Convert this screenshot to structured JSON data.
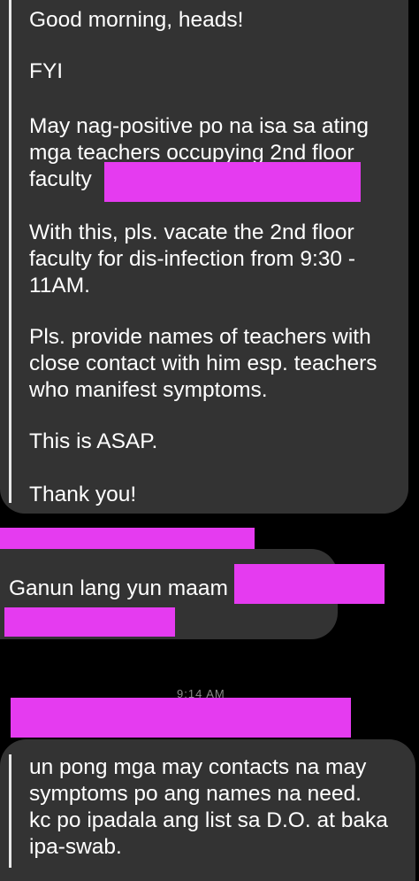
{
  "message1": {
    "greeting": "Good morning, heads!",
    "fyi": "FYI",
    "p1_l1": "May nag-positive po na isa sa ating",
    "p1_l2": "mga teachers occupying 2nd floor",
    "p1_l3": "faculty",
    "p2_l1": "With this, pls. vacate the 2nd floor",
    "p2_l2": "faculty for dis-infection from 9:30 -",
    "p2_l3": "11AM.",
    "p3_l1": "Pls. provide names of teachers with",
    "p3_l2": "close contact with him esp. teachers",
    "p3_l3": "who manifest symptoms.",
    "asap": "This is ASAP.",
    "thanks": "Thank you!"
  },
  "message2": {
    "text": "Ganun lang yun maam"
  },
  "timestamp": "9:14 AM",
  "message3": {
    "l1": "un pong mga may contacts na may",
    "l2": "symptoms po ang names na need.",
    "l3": "kc po ipadala ang list sa D.O. at baka",
    "l4": "ipa-swab."
  },
  "colors": {
    "background": "#000000",
    "bubble": "#333333",
    "redaction": "#e53bf0"
  }
}
